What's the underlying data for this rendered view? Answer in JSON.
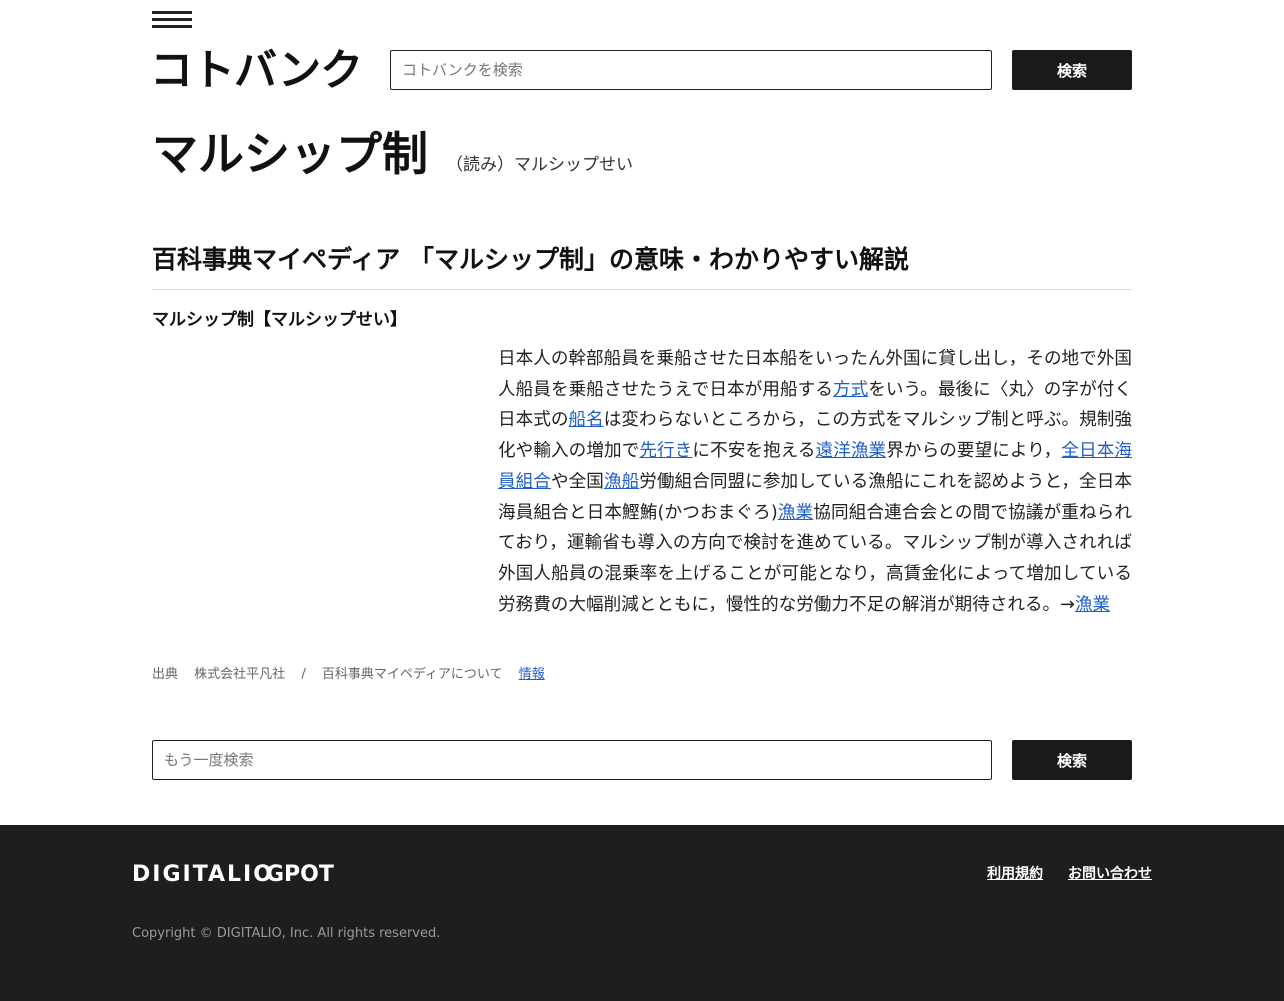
{
  "header": {
    "logo_text": "コトバンク",
    "search_placeholder": "コトバンクを検索",
    "search_button": "検索"
  },
  "title": {
    "word": "マルシップ制",
    "reading": "（読み）マルシップせい"
  },
  "section": {
    "dictionary": "百科事典マイペディア",
    "subtitle": "「マルシップ制」の意味・わかりやすい解説",
    "entry_head": "マルシップ制【マルシップせい】",
    "body": [
      {
        "t": "日本人の幹部船員を乗船させた日本船をいったん外国に貸し出し，その地で外国人船員を乗船させたうえで日本が用船する"
      },
      {
        "t": "方式",
        "link": true
      },
      {
        "t": "をいう。最後に〈丸〉の字が付く日本式の"
      },
      {
        "t": "船名",
        "link": true
      },
      {
        "t": "は変わらないところから，この方式をマルシップ制と呼ぶ。規制強化や輸入の増加で"
      },
      {
        "t": "先行き",
        "link": true
      },
      {
        "t": "に不安を抱える"
      },
      {
        "t": "遠洋漁業",
        "link": true
      },
      {
        "t": "界からの要望により，"
      },
      {
        "t": "全日本海員組合",
        "link": true
      },
      {
        "t": "や全国"
      },
      {
        "t": "漁船",
        "link": true
      },
      {
        "t": "労働組合同盟に参加している漁船にこれを認めようと，全日本海員組合と日本鰹鮪(かつおまぐろ)"
      },
      {
        "t": "漁業",
        "link": true
      },
      {
        "t": "協同組合連合会との間で協議が重ねられており，運輸省も導入の方向で検討を進めている。マルシップ制が導入されれば外国人船員の混乗率を上げることが可能となり，高賃金化によって増加している労務費の大幅削減とともに，慢性的な労働力不足の解消が期待される。→"
      },
      {
        "t": "漁業",
        "link": true
      }
    ],
    "source_label": "出典",
    "source_publisher": "株式会社平凡社",
    "source_sep": "/",
    "source_about": "百科事典マイペディアについて",
    "source_info": "情報"
  },
  "bottom_search": {
    "placeholder": "もう一度検索",
    "button": "検索"
  },
  "footer": {
    "brand1": "DIGITALIO",
    "brand2": "GPOT",
    "links": [
      "利用規約",
      "お問い合わせ"
    ],
    "copyright": "Copyright © DIGITALIO, Inc. All rights reserved."
  }
}
